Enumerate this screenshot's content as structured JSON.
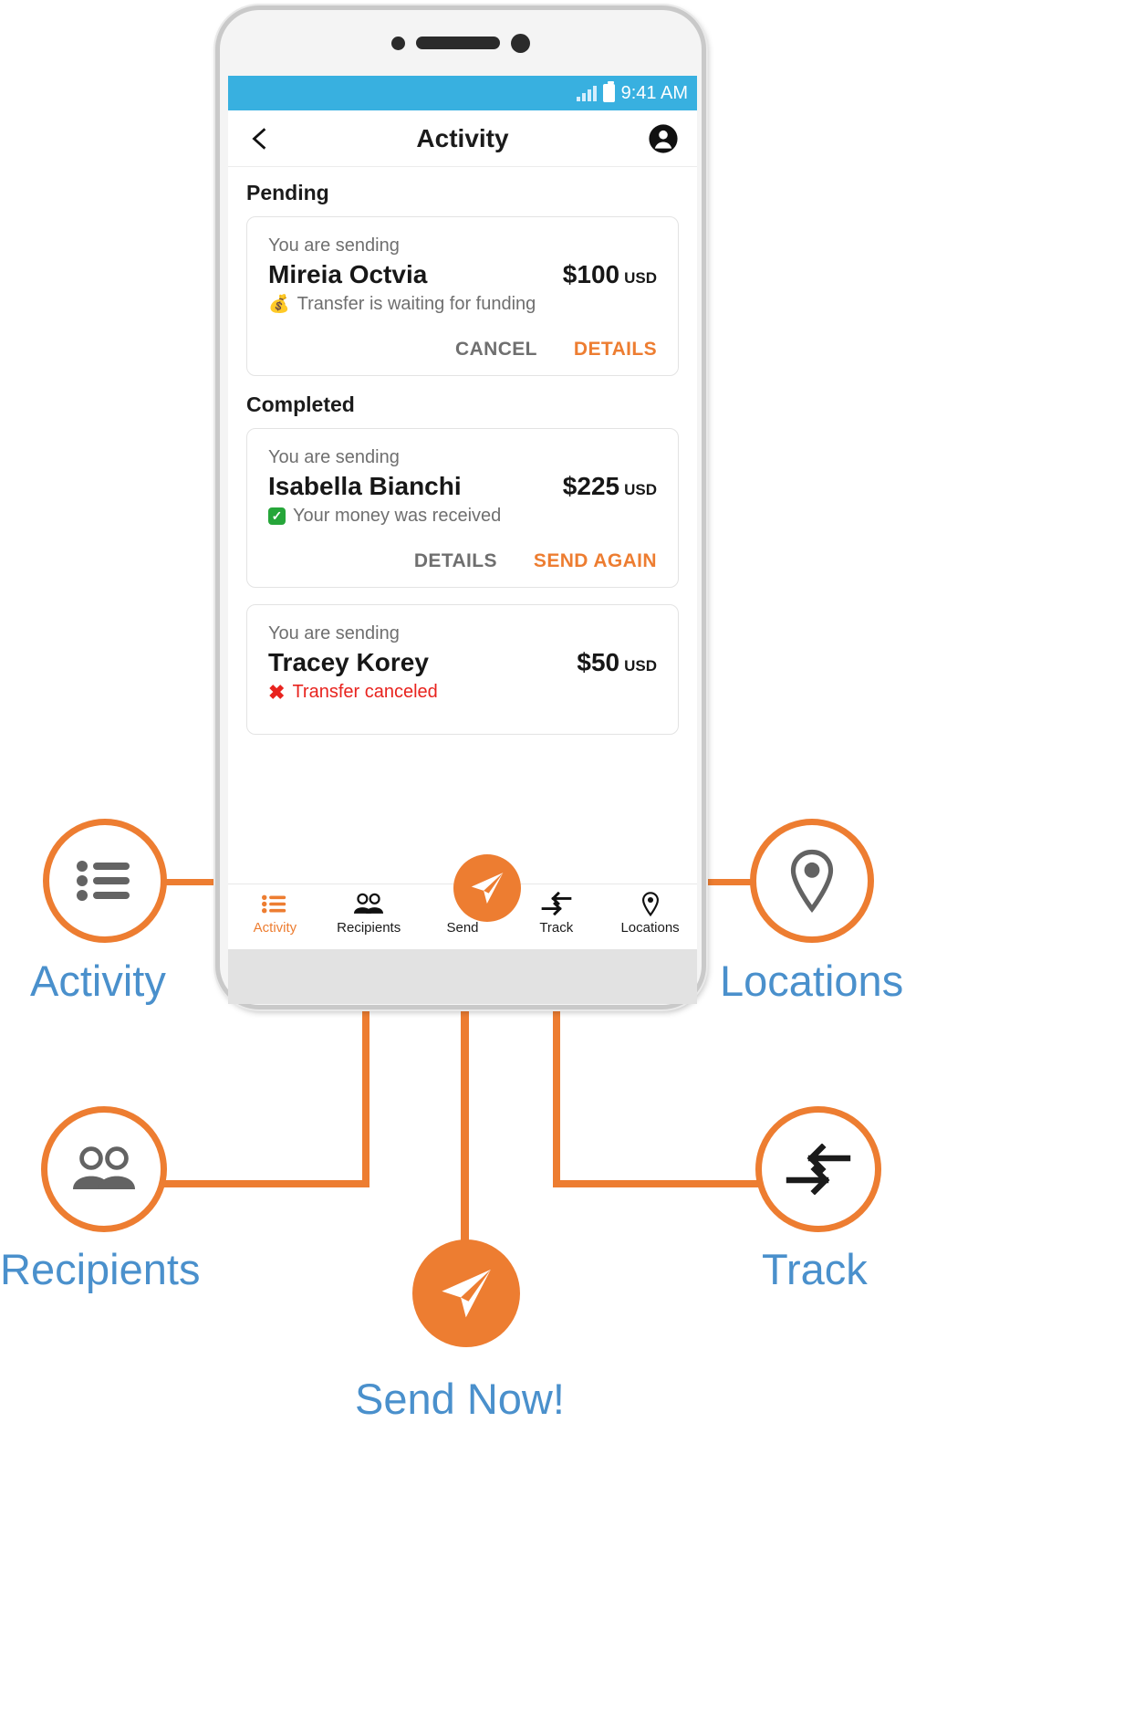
{
  "phone": {
    "statusbar": {
      "time": "9:41 AM",
      "signal_icon": "signal-bars-icon",
      "battery_icon": "battery-icon"
    },
    "appbar": {
      "back_icon": "back-chevron-icon",
      "title": "Activity",
      "profile_icon": "account-avatar-icon"
    },
    "sections": [
      {
        "title": "Pending",
        "cards": [
          {
            "subtitle": "You are sending",
            "name": "Mireia Octvia",
            "amount": "$100",
            "currency": "USD",
            "status_icon": "money-bag-emoji",
            "status": "Transfer is waiting for funding",
            "status_color": "#6f6f6f",
            "actions": [
              {
                "label": "CANCEL",
                "style": "grey"
              },
              {
                "label": "DETAILS",
                "style": "orange"
              }
            ]
          }
        ]
      },
      {
        "title": "Completed",
        "cards": [
          {
            "subtitle": "You are sending",
            "name": "Isabella Bianchi",
            "amount": "$225",
            "currency": "USD",
            "status_icon": "green-check-emoji",
            "status": "Your money was received",
            "status_color": "#6f6f6f",
            "actions": [
              {
                "label": "DETAILS",
                "style": "grey"
              },
              {
                "label": "SEND AGAIN",
                "style": "orange"
              }
            ]
          },
          {
            "subtitle": "You are sending",
            "name": "Tracey Korey",
            "amount": "$50",
            "currency": "USD",
            "status_icon": "red-cross-emoji",
            "status": "Transfer canceled",
            "status_color": "#e8231e",
            "actions": []
          }
        ]
      }
    ],
    "tabs": [
      {
        "label": "Activity",
        "icon": "list-bullet-icon",
        "active": true
      },
      {
        "label": "Recipients",
        "icon": "people-group-icon",
        "active": false
      },
      {
        "label": "Send",
        "icon": "paper-plane-icon",
        "active": false
      },
      {
        "label": "Track",
        "icon": "track-arrows-icon",
        "active": false
      },
      {
        "label": "Locations",
        "icon": "map-pin-icon",
        "active": false
      }
    ]
  },
  "callouts": [
    {
      "label": "Activity",
      "icon": "list-bullet-icon"
    },
    {
      "label": "Locations",
      "icon": "map-pin-icon"
    },
    {
      "label": "Recipients",
      "icon": "people-group-icon"
    },
    {
      "label": "Track",
      "icon": "track-arrows-icon"
    },
    {
      "label": "Send Now!",
      "icon": "paper-plane-icon"
    }
  ],
  "colors": {
    "accent_orange": "#ed7d31",
    "status_blue": "#38b0e0",
    "label_blue": "#4a90cc",
    "success_green": "#26a63a",
    "error_red": "#e8231e"
  }
}
